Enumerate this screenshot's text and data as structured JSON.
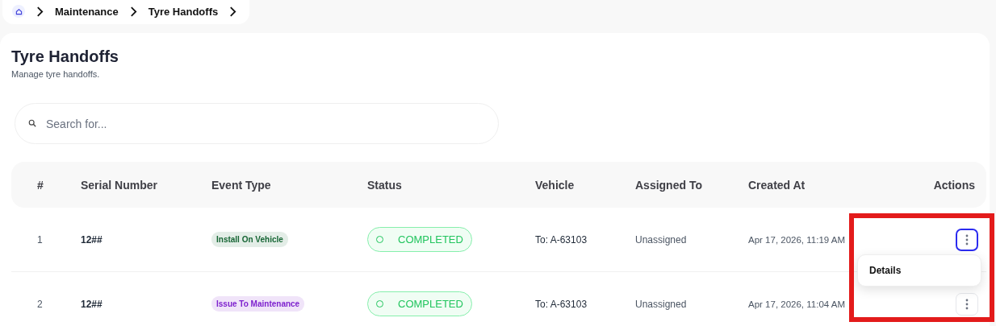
{
  "breadcrumb": [
    "Maintenance",
    "Tyre Handoffs"
  ],
  "page": {
    "title": "Tyre Handoffs",
    "subtitle": "Manage tyre handoffs."
  },
  "search": {
    "placeholder": "Search for..."
  },
  "table": {
    "columns": [
      "#",
      "Serial Number",
      "Event Type",
      "Status",
      "Vehicle",
      "Assigned To",
      "Created At",
      "Actions"
    ],
    "rows": [
      {
        "number": "1",
        "serial": "12##",
        "event_type": {
          "label": "Install On Vehicle",
          "color": "#166534"
        },
        "status": "COMPLETED",
        "vehicle": "To: A-63103",
        "assigned_to": "Unassigned",
        "created_at": "Apr 17, 2026, 11:19 AM",
        "menu_open": true,
        "highlighted": true,
        "menu": [
          "Details"
        ]
      },
      {
        "number": "2",
        "serial": "12##",
        "event_type": {
          "label": "Issue To Maintenance",
          "color": "#7e22ce"
        },
        "status": "COMPLETED",
        "vehicle": "To: A-63103",
        "assigned_to": "Unassigned",
        "created_at": "Apr 17, 2026, 11:04 AM",
        "menu_open": false,
        "highlighted": false,
        "menu": []
      }
    ]
  }
}
